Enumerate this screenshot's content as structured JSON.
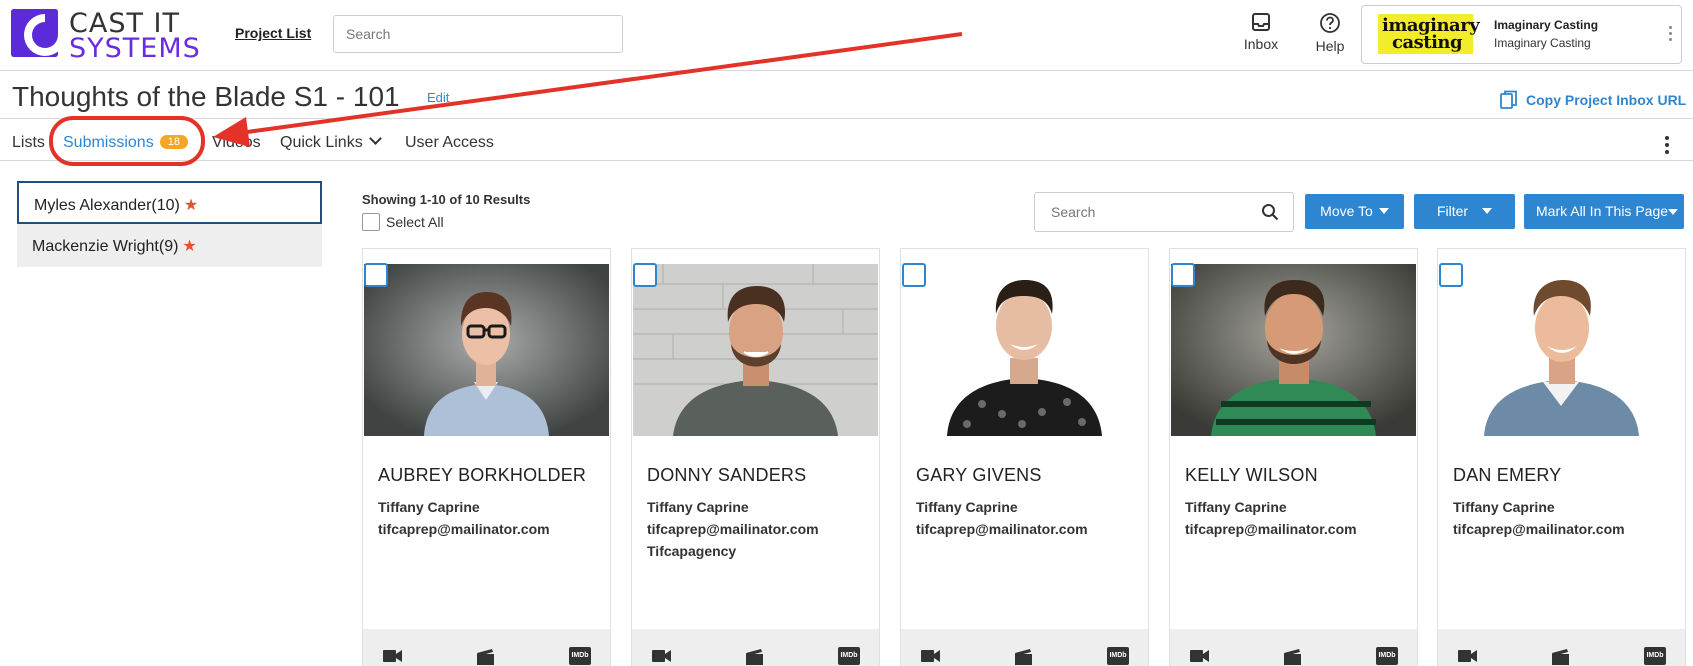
{
  "header": {
    "logo_line1": "CAST IT",
    "logo_line2": "SYSTEMS",
    "project_list_label": "Project List",
    "search_placeholder": "Search",
    "inbox_label": "Inbox",
    "help_label": "Help",
    "account": {
      "logo_text_1": "imaginary",
      "logo_text_2": "casting",
      "name": "Imaginary Casting",
      "sub": "Imaginary Casting"
    }
  },
  "title": {
    "text": "Thoughts of the Blade S1 - 101",
    "edit_label": "Edit",
    "copy_url_label": "Copy Project Inbox URL"
  },
  "tabs": {
    "lists": "Lists",
    "submissions": "Submissions",
    "submissions_count": "18",
    "videos": "Videos",
    "quick_links": "Quick Links",
    "user_access": "User Access"
  },
  "sidebar": {
    "items": [
      {
        "label": "Myles Alexander(10)"
      },
      {
        "label": "Mackenzie Wright(9)"
      }
    ]
  },
  "results": {
    "showing": "Showing 1-10 of 10 Results",
    "select_all": "Select All",
    "search_placeholder": "Search",
    "move_to": "Move To",
    "filter": "Filter",
    "mark_all": "Mark All In This Page"
  },
  "cards": [
    {
      "name": "AUBREY BORKHOLDER",
      "agent": "Tiffany Caprine",
      "email": "tifcaprep@mailinator.com",
      "agency": ""
    },
    {
      "name": "DONNY SANDERS",
      "agent": "Tiffany Caprine",
      "email": "tifcaprep@mailinator.com",
      "agency": "Tifcapagency"
    },
    {
      "name": "GARY GIVENS",
      "agent": "Tiffany Caprine",
      "email": "tifcaprep@mailinator.com",
      "agency": ""
    },
    {
      "name": "KELLY WILSON",
      "agent": "Tiffany Caprine",
      "email": "tifcaprep@mailinator.com",
      "agency": ""
    },
    {
      "name": "DAN EMERY",
      "agent": "Tiffany Caprine",
      "email": "tifcaprep@mailinator.com",
      "agency": ""
    }
  ],
  "colors": {
    "accent": "#2f86d0",
    "brand_purple": "#5b2bd9",
    "badge": "#f5a623",
    "star": "#e2542a",
    "annotation": "#e33228"
  }
}
